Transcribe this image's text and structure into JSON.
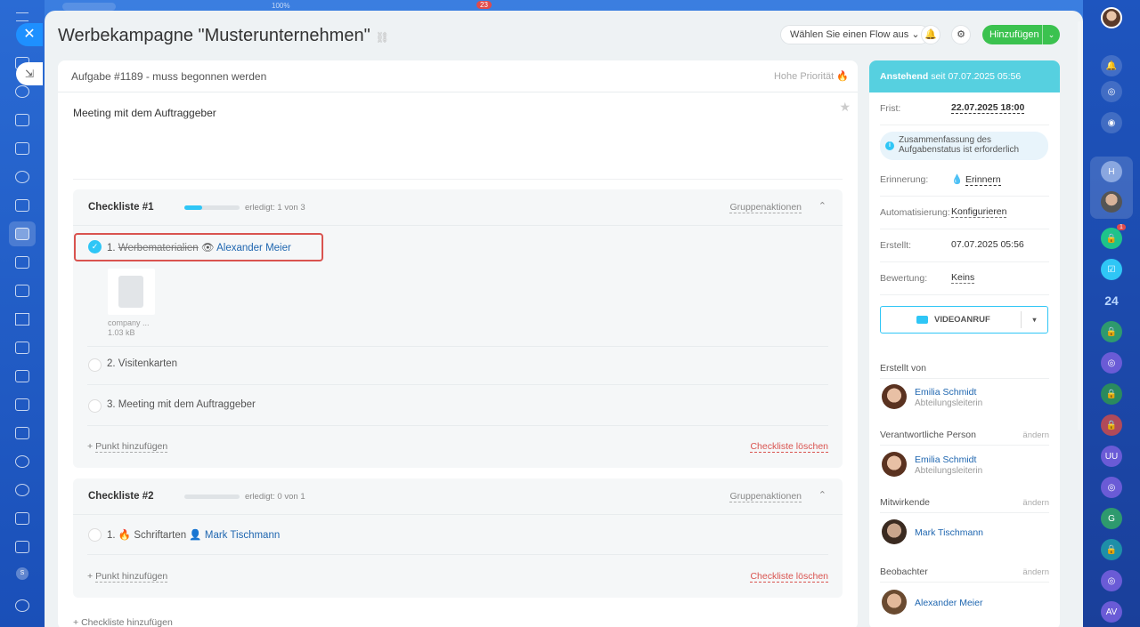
{
  "page": {
    "title": "Werbekampagne \"Musterunternehmen\"",
    "flow_select": "Wählen Sie einen Flow aus",
    "add_label": "Hinzufügen",
    "top_percent": "100%",
    "top_badge": "23"
  },
  "task": {
    "header": "Aufgabe #1189 - muss begonnen werden",
    "priority": "Hohe Priorität",
    "description": "Meeting mit dem Auftraggeber"
  },
  "checklists": [
    {
      "title": "Checkliste #1",
      "progress": 0.33,
      "done_text": "erledigt: 1 von 3",
      "group_actions": "Gruppenaktionen",
      "items": [
        {
          "num": "1.",
          "label": "Werbematerialien",
          "user": "Alexander Meier",
          "done": true
        },
        {
          "num": "2.",
          "label": "Visitenkarten",
          "done": false
        },
        {
          "num": "3.",
          "label": "Meeting mit dem Auftraggeber",
          "done": false
        }
      ],
      "file": {
        "name": "company ...",
        "size": "1.03 kB"
      },
      "add_point": "Punkt hinzufügen",
      "delete": "Checkliste löschen"
    },
    {
      "title": "Checkliste #2",
      "progress": 0,
      "done_text": "erledigt: 0 von 1",
      "group_actions": "Gruppenaktionen",
      "items": [
        {
          "num": "1.",
          "label": "Schriftarten",
          "user": "Mark Tischmann",
          "done": false
        }
      ],
      "add_point": "Punkt hinzufügen",
      "delete": "Checkliste löschen"
    }
  ],
  "add_checklist": "Checkliste hinzufügen",
  "sidebar": {
    "status": "Anstehend",
    "status_since": "seit 07.07.2025 05:56",
    "deadline_label": "Frist:",
    "deadline": "22.07.2025 18:00",
    "summary_note": "Zusammenfassung des Aufgabenstatus ist erforderlich",
    "reminder_label": "Erinnerung:",
    "reminder": "Erinnern",
    "automation_label": "Automatisierung:",
    "automation": "Konfigurieren",
    "created_label": "Erstellt:",
    "created": "07.07.2025 05:56",
    "rating_label": "Bewertung:",
    "rating": "Keins",
    "video_call": "VIDEOANRUF",
    "created_by_label": "Erstellt von",
    "creator": {
      "name": "Emilia Schmidt",
      "role": "Abteilungsleiterin"
    },
    "responsible_label": "Verantwortliche Person",
    "responsible": {
      "name": "Emilia Schmidt",
      "role": "Abteilungsleiterin"
    },
    "participants_label": "Mitwirkende",
    "participant": "Mark Tischmann",
    "observers_label": "Beobachter",
    "observer": "Alexander Meier",
    "change": "ändern"
  },
  "right_bar": {
    "badge_count": "1",
    "b24_label": "24",
    "initials": [
      "H",
      "UU",
      "G",
      "AV"
    ]
  },
  "colors": {
    "accent": "#2fc6f6",
    "add_button": "#3bc24f",
    "status_header": "#56d0e0",
    "highlight": "#d9534f"
  }
}
